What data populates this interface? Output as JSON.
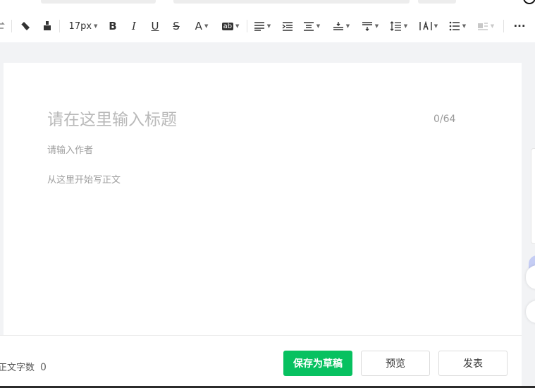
{
  "toolbar": {
    "font_size": "17px",
    "items": [
      {
        "name": "undo",
        "label": "⮌"
      },
      {
        "name": "eraser",
        "label": "eraser"
      },
      {
        "name": "format-painter",
        "label": "brush"
      },
      {
        "name": "bold",
        "label": "B"
      },
      {
        "name": "italic",
        "label": "I"
      },
      {
        "name": "underline",
        "label": "U"
      },
      {
        "name": "strikethrough",
        "label": "S"
      },
      {
        "name": "font-color",
        "label": "A"
      },
      {
        "name": "background-color",
        "label": "ab"
      },
      {
        "name": "more",
        "label": "···"
      }
    ]
  },
  "editor": {
    "title_placeholder": "请在这里输入标题",
    "title_counter": "0/64",
    "author_placeholder": "请输入作者",
    "body_placeholder": "从这里开始写正文"
  },
  "footer": {
    "word_count_label": "正文字数",
    "word_count_value": "0",
    "save_draft_label": "保存为草稿",
    "preview_label": "预览",
    "publish_label": "发表"
  },
  "colors": {
    "accent": "#07c160",
    "background": "#f2f3f5"
  }
}
